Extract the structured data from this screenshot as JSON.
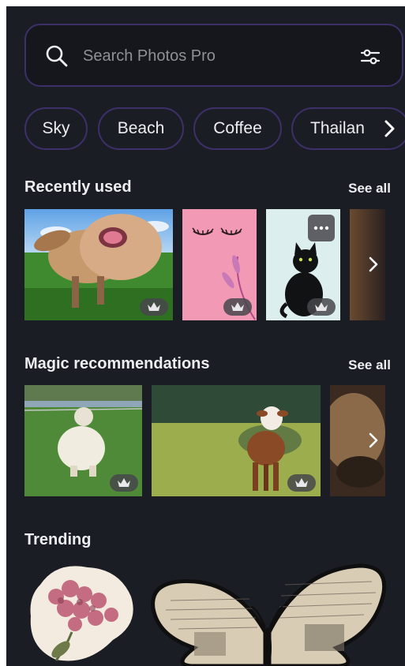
{
  "search": {
    "placeholder": "Search Photos Pro",
    "icon": "search-icon",
    "filter_icon": "filter-sliders-icon"
  },
  "chips": [
    {
      "label": "Sky"
    },
    {
      "label": "Beach"
    },
    {
      "label": "Coffee"
    },
    {
      "label": "Thailan"
    }
  ],
  "sections": {
    "recent": {
      "title": "Recently used",
      "see_all": "See all"
    },
    "magic": {
      "title": "Magic recommendations",
      "see_all": "See all"
    },
    "trending": {
      "title": "Trending"
    }
  },
  "colors": {
    "background": "#1b1d24",
    "accent_border": "#3c2f6a",
    "text": "#eceef2"
  }
}
